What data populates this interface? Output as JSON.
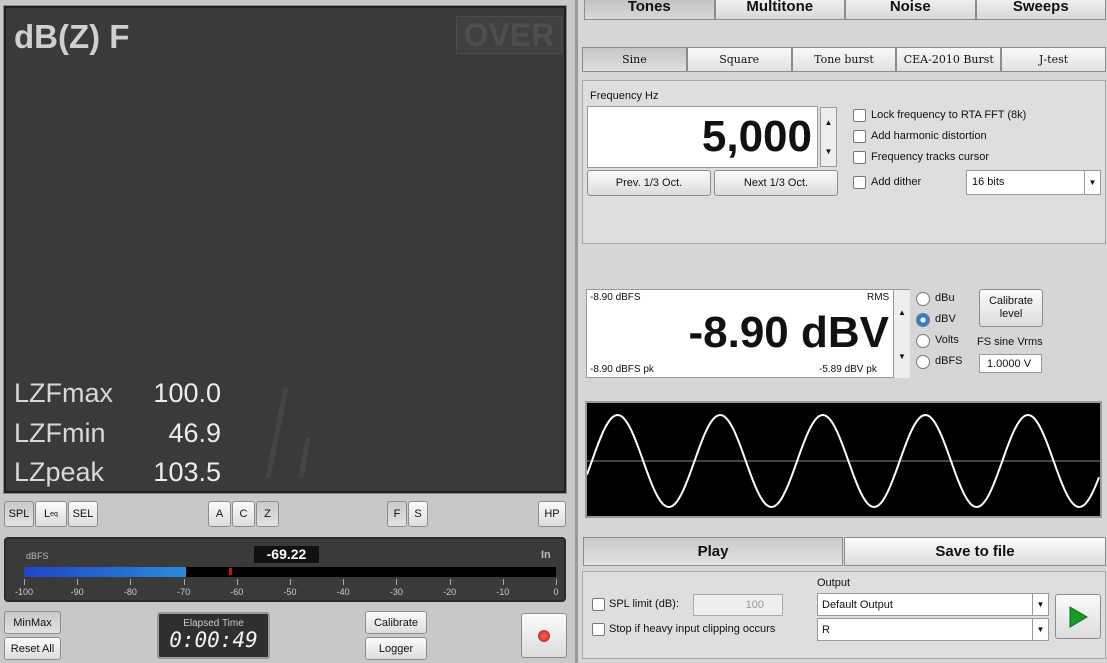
{
  "meter": {
    "title": "dB(Z) F",
    "over": "OVER",
    "stats": [
      {
        "label": "LZFmax",
        "value": "100.0"
      },
      {
        "label": "LZFmin",
        "value": "46.9"
      },
      {
        "label": "LZpeak",
        "value": "103.5"
      }
    ]
  },
  "mode_buttons": {
    "spl": "SPL",
    "leq_main": "L",
    "leq_sub": "eq",
    "sel": "SEL",
    "a": "A",
    "c": "C",
    "z": "Z",
    "f": "F",
    "s": "S",
    "hp": "HP"
  },
  "level_bar": {
    "unit_label": "dBFS",
    "reading": "-69.22",
    "channel": "In",
    "level_fraction": 0.304,
    "ticks": [
      "-100",
      "-90",
      "-80",
      "-70",
      "-60",
      "-50",
      "-40",
      "-30",
      "-20",
      "-10",
      "0"
    ]
  },
  "bottom_left": {
    "minmax": "MinMax",
    "reset_all": "Reset All",
    "elapsed_label": "Elapsed Time",
    "elapsed_value": "0:00:49",
    "calibrate": "Calibrate",
    "logger": "Logger"
  },
  "tabs": [
    "Tones",
    "Multitone",
    "Noise",
    "Sweeps"
  ],
  "subtabs": [
    "Sine",
    "Square",
    "Tone burst",
    "CEA-2010 Burst",
    "J-test"
  ],
  "frequency": {
    "label": "Frequency Hz",
    "value": "5,000",
    "prev": "Prev. 1/3 Oct.",
    "next": "Next 1/3 Oct."
  },
  "options": {
    "lock": "Lock frequency to RTA FFT (8k)",
    "harmonic": "Add harmonic distortion",
    "tracks": "Frequency tracks cursor",
    "dither": "Add dither",
    "bits": "16 bits"
  },
  "level": {
    "top_left": "-8.90 dBFS",
    "top_right": "RMS",
    "value": "-8.90 dBV",
    "bottom_left": "-8.90 dBFS pk",
    "bottom_right": "-5.89 dBV pk",
    "units": [
      "dBu",
      "dBV",
      "Volts",
      "dBFS"
    ],
    "selected_unit": "dBV",
    "calibrate": "Calibrate level",
    "fs_label": "FS sine Vrms",
    "fs_value": "1.0000 V"
  },
  "waveform": {
    "cycles": 5,
    "color": "#ffffff",
    "bg": "#000000"
  },
  "output": {
    "play": "Play",
    "save": "Save to file",
    "spl_limit_label": "SPL limit (dB):",
    "spl_limit_value": "100",
    "stop_label": "Stop if heavy input clipping occurs",
    "output_label": "Output",
    "device": "Default Output",
    "channel": "R"
  },
  "colors": {
    "bar_fill": "#1f6fd0",
    "peak_marker": "#d01010",
    "play_arrow": "#1a9a2a"
  }
}
